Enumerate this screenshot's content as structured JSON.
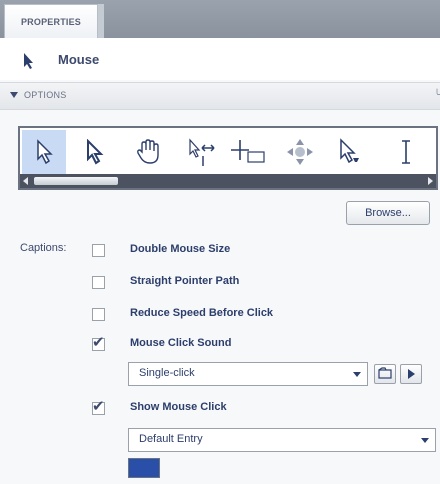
{
  "tab": {
    "label": "PROPERTIES"
  },
  "object": {
    "name": "Mouse",
    "icon": "mouse-pointer-icon"
  },
  "options_section": {
    "label": "OPTIONS",
    "tail": "╰"
  },
  "pointers": [
    {
      "icon": "arrow-pointer-icon",
      "selected": true
    },
    {
      "icon": "arrow-outline-pointer-icon",
      "selected": false
    },
    {
      "icon": "hand-pointer-icon",
      "selected": false
    },
    {
      "icon": "resize-cursor-icon",
      "selected": false
    },
    {
      "icon": "crosshair-cursor-icon",
      "selected": false
    },
    {
      "icon": "move-cursor-icon",
      "selected": false
    },
    {
      "icon": "arrow-busy-pointer-icon",
      "selected": false
    },
    {
      "icon": "text-ibeam-cursor-icon",
      "selected": false
    }
  ],
  "browse_button": {
    "label": "Browse..."
  },
  "captions": {
    "label": "Captions:",
    "options": [
      {
        "label": "Double Mouse Size",
        "checked": false
      },
      {
        "label": "Straight Pointer Path",
        "checked": false
      },
      {
        "label": "Reduce Speed Before Click",
        "checked": false
      },
      {
        "label": "Mouse Click Sound",
        "checked": true
      },
      {
        "label": "Show Mouse Click",
        "checked": true
      }
    ]
  },
  "click_sound_dropdown": {
    "value": "Single-click"
  },
  "show_click_dropdown": {
    "value": "Default Entry"
  },
  "click_color": "#2a4fa8"
}
